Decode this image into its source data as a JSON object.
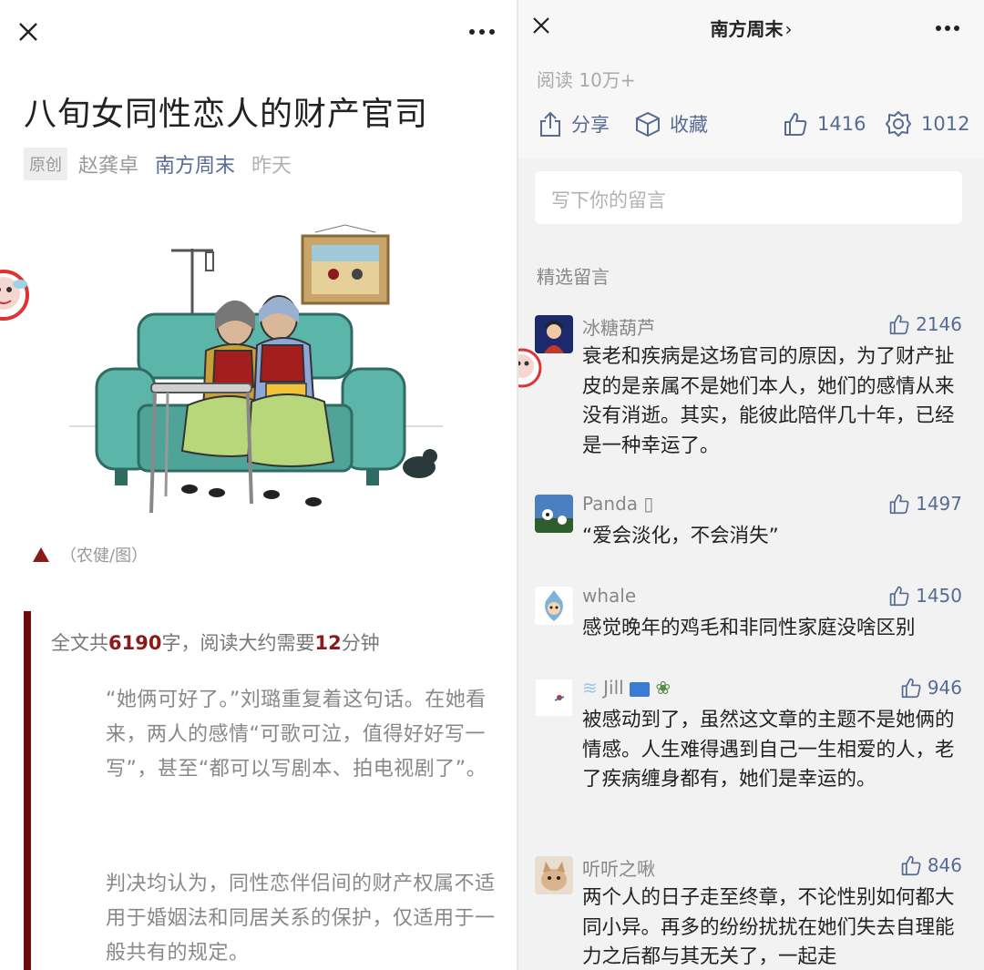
{
  "left": {
    "title": "八旬女同性恋人的财产官司",
    "meta": {
      "original_tag": "原创",
      "author": "赵龚卓",
      "account": "南方周末",
      "date": "昨天"
    },
    "caption": "（农健/图）",
    "reading_time": {
      "prefix": "全文共",
      "chars": "6190",
      "middle": "字，阅读大约需要",
      "minutes": "12",
      "suffix": "分钟"
    },
    "paragraphs": [
      "“她俩可好了。”刘璐重复着这句话。在她看来，两人的感情“可歌可泣，值得好好写一写”，甚至“都可以写剧本、拍电视剧了”。",
      "判决均认为，同性恋伴侣间的财产权属不适用于婚姻法和同居关系的保护，仅适用于一般共有的规定。"
    ]
  },
  "right": {
    "account_header": "南方周末",
    "header_chevron": "›",
    "read_count": "阅读 10万+",
    "actions": {
      "share": "分享",
      "favorite": "收藏",
      "like_count": "1416",
      "wow_count": "1012"
    },
    "comment_placeholder": "写下你的留言",
    "selected_label": "精选留言",
    "comments": [
      {
        "name": "冰糖葫芦",
        "likes": "2146",
        "text": "衰老和疾病是这场官司的原因，为了财产扯皮的是亲属不是她们本人，她们的感情从来没有消逝。其实，能彼此陪伴几十年，已经是一种幸运了。"
      },
      {
        "name": "Panda ▯",
        "likes": "1497",
        "text": "“爱会淡化，不会消失”"
      },
      {
        "name": "whale",
        "likes": "1450",
        "text": "感觉晚年的鸡毛和非同性家庭没啥区别"
      },
      {
        "name": "Jill",
        "likes": "946",
        "text": "被感动到了，虽然这文章的主题不是她俩的情感。人生难得遇到自己一生相爱的人，老了疾病缠身都有，她们是幸运的。"
      },
      {
        "name": "听听之啾",
        "likes": "846",
        "text": "两个人的日子走至终章，不论性别如何都大同小异。再多的纷纷扰扰在她们失去自理能力之后都与其无关了，一起走"
      }
    ]
  },
  "colors": {
    "link_blue": "#576b95",
    "accent_red": "#8b1a1a",
    "quote_bar": "#6b0c0c",
    "sofa_teal": "#5bb5a8"
  },
  "icons": [
    "close-icon",
    "more-icon",
    "share-icon",
    "favorite-icon",
    "thumbs-up-icon",
    "wow-icon",
    "triangle-icon"
  ]
}
